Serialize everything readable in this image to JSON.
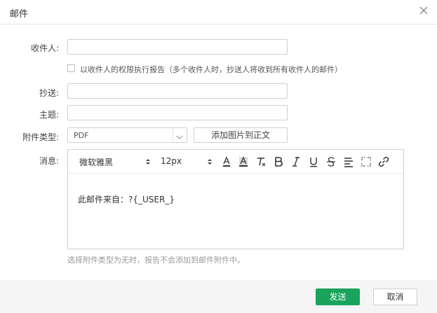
{
  "dialog": {
    "title": "邮件"
  },
  "form": {
    "recipient_label": "收件人:",
    "recipient_value": "",
    "permission_checkbox_checked": false,
    "permission_checkbox_label": "以收件人的权限执行报告（多个收件人时，抄送人将收到所有收件人的邮件）",
    "cc_label": "抄送:",
    "cc_value": "",
    "subject_label": "主题:",
    "subject_value": "",
    "attachment_type_label": "附件类型:",
    "attachment_type_value": "PDF",
    "add_image_button": "添加图片到正文",
    "message_label": "消息:",
    "hint": "选择附件类型为无时，报告不会添加到邮件附件中。"
  },
  "editor": {
    "font_family": "微软雅黑",
    "font_size": "12px",
    "content": "此邮件来自：?{_USER_}",
    "toolbar_icons": [
      "font-color-icon",
      "highlight-icon",
      "clear-format-icon",
      "bold-icon",
      "italic-icon",
      "underline-icon",
      "strikethrough-icon",
      "align-icon",
      "fullscreen-icon",
      "link-icon"
    ]
  },
  "footer": {
    "send_button": "发送",
    "cancel_button": "取消"
  },
  "colors": {
    "primary": "#1aa35b",
    "border": "#cfcfcf",
    "footer_bg": "#f5f5f5",
    "hint": "#999999"
  }
}
